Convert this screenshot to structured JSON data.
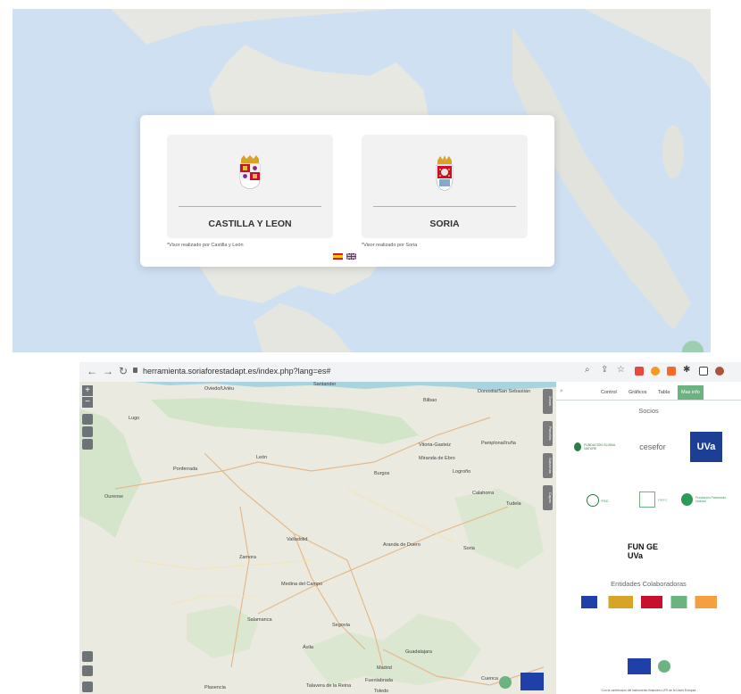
{
  "landing": {
    "cards": [
      {
        "label": "CASTILLA Y LEON",
        "note": "*Visor realizado por Castilla y León"
      },
      {
        "label": "SORIA",
        "note": "*Visor realizado por Soria"
      }
    ],
    "languages": [
      "es",
      "en"
    ]
  },
  "browser": {
    "url": "herramienta.soriaforestadapt.es/index.php?lang=es#"
  },
  "map": {
    "cities": [
      "Oviedo/Uviéu",
      "Santander",
      "Bilbao",
      "Donostia/San Sebastián",
      "Lugo",
      "León",
      "Burgos",
      "Vitoria-Gasteiz",
      "Pamplona/Iruña",
      "Logroño",
      "Ponferrada",
      "Ourense",
      "Valladolid",
      "Zamora",
      "Soria",
      "Salamanca",
      "Segovia",
      "Ávila",
      "Guadalajara",
      "Madrid",
      "Tudela",
      "Cuenca",
      "Toledo",
      "Plasencia",
      "Medina del Campo",
      "Aranda de Duero",
      "Miranda de Ebro",
      "Calahorra",
      "Talavera de la Reina",
      "Fuenlabrada"
    ],
    "zoom_buttons": [
      "+",
      "−"
    ],
    "side_tabs": [
      "Zonas",
      "Parcelas",
      "Subzonas",
      "Capas"
    ]
  },
  "panel": {
    "tabs": [
      "Control",
      "Gráficos",
      "Tabla",
      "Mas info"
    ],
    "socios_title": "Socios",
    "colaboradoras_title": "Entidades Colaboradoras",
    "logos": [
      "FUNDACIÓN GLOBAL NATURE",
      "cesefor",
      "UVa",
      "FSC",
      "PEFC",
      "Fundación Patrimonio Natural",
      "FUN GE UVa"
    ],
    "footer": "Con la contribución del instrumento financiero LIFE de la Unión Europea"
  },
  "colors": {
    "accent": "#6db381",
    "rule": "#8fc59b",
    "sea": "#cfe0f3",
    "land": "#e9eadf"
  }
}
